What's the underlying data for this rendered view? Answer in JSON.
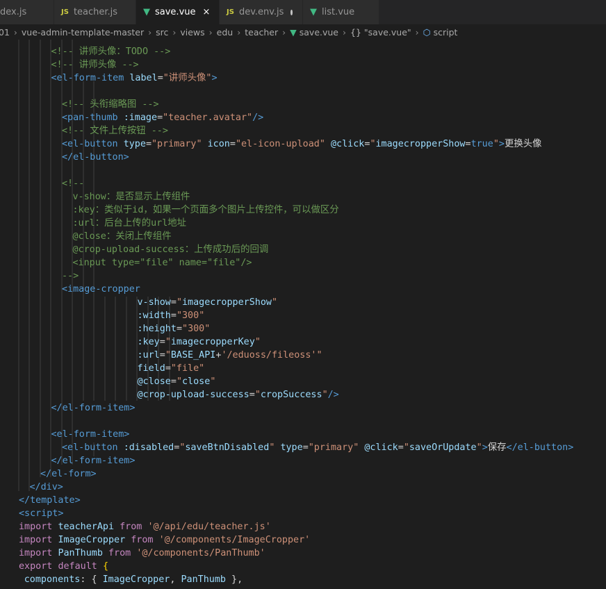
{
  "tabs": [
    {
      "icon": "",
      "label": "dex.js",
      "state": "",
      "active": false
    },
    {
      "icon": "JS",
      "label": "teacher.js",
      "state": "",
      "active": false
    },
    {
      "icon": "V",
      "label": "save.vue",
      "state": "×",
      "active": true
    },
    {
      "icon": "JS",
      "label": "dev.env.js",
      "state": "dot",
      "active": false
    },
    {
      "icon": "V",
      "label": "list.vue",
      "state": "",
      "active": false
    }
  ],
  "breadcrumb": {
    "items": [
      "01",
      "vue-admin-template-master",
      "src",
      "views",
      "edu",
      "teacher",
      "save.vue",
      "\"save.vue\"",
      "script"
    ],
    "braces": "{}"
  },
  "code": [
    {
      "indent": 6,
      "tokens": [
        [
          "cmt",
          "<!-- 讲师头像：TODO -->"
        ]
      ]
    },
    {
      "indent": 6,
      "tokens": [
        [
          "cmt",
          "<!-- 讲师头像 -->"
        ]
      ]
    },
    {
      "indent": 6,
      "tokens": [
        [
          "tag",
          "<el-form-item"
        ],
        [
          "txt",
          " "
        ],
        [
          "attr",
          "label"
        ],
        [
          "txt",
          "="
        ],
        [
          "str",
          "\"讲师头像\""
        ],
        [
          "tag",
          ">"
        ]
      ]
    },
    {
      "indent": 0,
      "tokens": []
    },
    {
      "indent": 8,
      "tokens": [
        [
          "cmt",
          "<!-- 头衔缩略图 -->"
        ]
      ]
    },
    {
      "indent": 8,
      "tokens": [
        [
          "tag",
          "<pan-thumb"
        ],
        [
          "txt",
          " "
        ],
        [
          "attr",
          ":image"
        ],
        [
          "txt",
          "="
        ],
        [
          "str",
          "\"teacher.avatar\""
        ],
        [
          "tag",
          "/>"
        ]
      ]
    },
    {
      "indent": 8,
      "tokens": [
        [
          "cmt",
          "<!-- 文件上传按钮 -->"
        ]
      ]
    },
    {
      "indent": 8,
      "tokens": [
        [
          "tag",
          "<el-button"
        ],
        [
          "txt",
          " "
        ],
        [
          "attr",
          "type"
        ],
        [
          "txt",
          "="
        ],
        [
          "str",
          "\"primary\""
        ],
        [
          "txt",
          " "
        ],
        [
          "attr",
          "icon"
        ],
        [
          "txt",
          "="
        ],
        [
          "str",
          "\"el-icon-upload\""
        ],
        [
          "txt",
          " "
        ],
        [
          "attr",
          "@click"
        ],
        [
          "txt",
          "="
        ],
        [
          "str",
          "\""
        ],
        [
          "var",
          "imagecropperShow"
        ],
        [
          "txt",
          "="
        ],
        [
          "kwb",
          "true"
        ],
        [
          "str",
          "\""
        ],
        [
          "tag",
          ">"
        ],
        [
          "txt",
          "更换头像"
        ]
      ]
    },
    {
      "indent": 8,
      "tokens": [
        [
          "tag",
          "</el-button>"
        ]
      ]
    },
    {
      "indent": 0,
      "tokens": []
    },
    {
      "indent": 8,
      "tokens": [
        [
          "cmt",
          "<!--"
        ]
      ]
    },
    {
      "indent": 10,
      "tokens": [
        [
          "cmt",
          "v-show：是否显示上传组件"
        ]
      ]
    },
    {
      "indent": 10,
      "tokens": [
        [
          "cmt",
          ":key：类似于id，如果一个页面多个图片上传控件，可以做区分"
        ]
      ]
    },
    {
      "indent": 10,
      "tokens": [
        [
          "cmt",
          ":url：后台上传的url地址"
        ]
      ]
    },
    {
      "indent": 10,
      "tokens": [
        [
          "cmt",
          "@close：关闭上传组件"
        ]
      ]
    },
    {
      "indent": 10,
      "tokens": [
        [
          "cmt",
          "@crop-upload-success：上传成功后的回调"
        ]
      ]
    },
    {
      "indent": 10,
      "tokens": [
        [
          "cmt",
          "<input type=\"file\" name=\"file\"/>"
        ]
      ]
    },
    {
      "indent": 8,
      "tokens": [
        [
          "cmt",
          "-->"
        ]
      ]
    },
    {
      "indent": 8,
      "tokens": [
        [
          "tag",
          "<image-cropper"
        ]
      ]
    },
    {
      "indent": 22,
      "tokens": [
        [
          "attr",
          "v-show"
        ],
        [
          "txt",
          "="
        ],
        [
          "str",
          "\""
        ],
        [
          "var",
          "imagecropperShow"
        ],
        [
          "str",
          "\""
        ]
      ]
    },
    {
      "indent": 22,
      "tokens": [
        [
          "attr",
          ":width"
        ],
        [
          "txt",
          "="
        ],
        [
          "str",
          "\""
        ],
        [
          "str",
          "300"
        ],
        [
          "str",
          "\""
        ]
      ]
    },
    {
      "indent": 22,
      "tokens": [
        [
          "attr",
          ":height"
        ],
        [
          "txt",
          "="
        ],
        [
          "str",
          "\""
        ],
        [
          "str",
          "300"
        ],
        [
          "str",
          "\""
        ]
      ]
    },
    {
      "indent": 22,
      "tokens": [
        [
          "attr",
          ":key"
        ],
        [
          "txt",
          "="
        ],
        [
          "str",
          "\""
        ],
        [
          "var",
          "imagecropperKey"
        ],
        [
          "str",
          "\""
        ]
      ]
    },
    {
      "indent": 22,
      "tokens": [
        [
          "attr",
          ":url"
        ],
        [
          "txt",
          "="
        ],
        [
          "str",
          "\""
        ],
        [
          "var",
          "BASE_API"
        ],
        [
          "txt",
          "+"
        ],
        [
          "str",
          "'/eduoss/fileoss'"
        ],
        [
          "str",
          "\""
        ]
      ]
    },
    {
      "indent": 22,
      "tokens": [
        [
          "attr",
          "field"
        ],
        [
          "txt",
          "="
        ],
        [
          "str",
          "\"file\""
        ]
      ]
    },
    {
      "indent": 22,
      "tokens": [
        [
          "attr",
          "@close"
        ],
        [
          "txt",
          "="
        ],
        [
          "str",
          "\""
        ],
        [
          "var",
          "close"
        ],
        [
          "str",
          "\""
        ]
      ]
    },
    {
      "indent": 22,
      "tokens": [
        [
          "attr",
          "@crop-upload-success"
        ],
        [
          "txt",
          "="
        ],
        [
          "str",
          "\""
        ],
        [
          "var",
          "cropSuccess"
        ],
        [
          "str",
          "\""
        ],
        [
          "tag",
          "/>"
        ]
      ]
    },
    {
      "indent": 6,
      "tokens": [
        [
          "tag",
          "</el-form-item>"
        ]
      ]
    },
    {
      "indent": 0,
      "tokens": []
    },
    {
      "indent": 6,
      "tokens": [
        [
          "tag",
          "<el-form-item>"
        ]
      ]
    },
    {
      "indent": 8,
      "tokens": [
        [
          "tag",
          "<el-button"
        ],
        [
          "txt",
          " "
        ],
        [
          "attr",
          ":disabled"
        ],
        [
          "txt",
          "="
        ],
        [
          "str",
          "\""
        ],
        [
          "var",
          "saveBtnDisabled"
        ],
        [
          "str",
          "\""
        ],
        [
          "txt",
          " "
        ],
        [
          "attr",
          "type"
        ],
        [
          "txt",
          "="
        ],
        [
          "str",
          "\"primary\""
        ],
        [
          "txt",
          " "
        ],
        [
          "attr",
          "@click"
        ],
        [
          "txt",
          "="
        ],
        [
          "str",
          "\""
        ],
        [
          "var",
          "saveOrUpdate"
        ],
        [
          "str",
          "\""
        ],
        [
          "tag",
          ">"
        ],
        [
          "txt",
          "保存"
        ],
        [
          "tag",
          "</el-button>"
        ]
      ]
    },
    {
      "indent": 6,
      "tokens": [
        [
          "tag",
          "</el-form-item>"
        ]
      ]
    },
    {
      "indent": 4,
      "tokens": [
        [
          "tag",
          "</el-form>"
        ]
      ]
    },
    {
      "indent": 2,
      "tokens": [
        [
          "tag",
          "</div>"
        ]
      ]
    },
    {
      "indent": 0,
      "tokens": [
        [
          "tag",
          "</template>"
        ]
      ]
    },
    {
      "indent": 0,
      "tokens": [
        [
          "tag",
          "<script>"
        ]
      ]
    },
    {
      "indent": 0,
      "tokens": [
        [
          "kw",
          "import"
        ],
        [
          "txt",
          " "
        ],
        [
          "var",
          "teacherApi"
        ],
        [
          "txt",
          " "
        ],
        [
          "kw",
          "from"
        ],
        [
          "txt",
          " "
        ],
        [
          "str",
          "'@/api/edu/teacher.js'"
        ]
      ]
    },
    {
      "indent": 0,
      "tokens": [
        [
          "kw",
          "import"
        ],
        [
          "txt",
          " "
        ],
        [
          "var",
          "ImageCropper"
        ],
        [
          "txt",
          " "
        ],
        [
          "kw",
          "from"
        ],
        [
          "txt",
          " "
        ],
        [
          "str",
          "'@/components/ImageCropper'"
        ]
      ]
    },
    {
      "indent": 0,
      "tokens": [
        [
          "kw",
          "import"
        ],
        [
          "txt",
          " "
        ],
        [
          "var",
          "PanThumb"
        ],
        [
          "txt",
          " "
        ],
        [
          "kw",
          "from"
        ],
        [
          "txt",
          " "
        ],
        [
          "str",
          "'@/components/PanThumb'"
        ]
      ]
    },
    {
      "indent": 0,
      "tokens": [
        [
          "kw",
          "export"
        ],
        [
          "txt",
          " "
        ],
        [
          "kw",
          "default"
        ],
        [
          "txt",
          " "
        ],
        [
          "brk",
          "{"
        ]
      ]
    },
    {
      "indent": 1,
      "tokens": [
        [
          "var",
          "components"
        ],
        [
          "txt",
          ": { "
        ],
        [
          "var",
          "ImageCropper"
        ],
        [
          "txt",
          ", "
        ],
        [
          "var",
          "PanThumb"
        ],
        [
          "txt",
          " },"
        ]
      ]
    }
  ]
}
